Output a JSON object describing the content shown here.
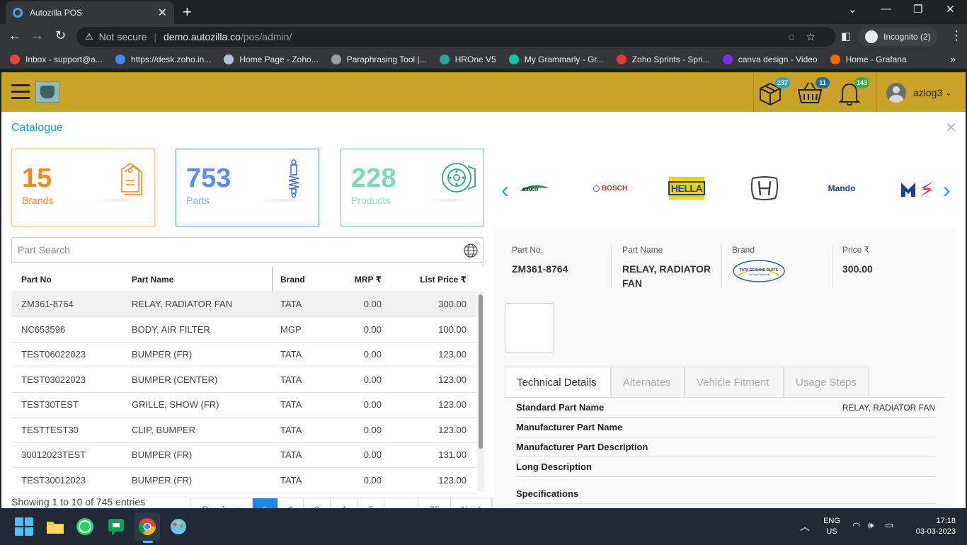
{
  "browser": {
    "tab_title": "Autozilla POS",
    "security_label": "Not secure",
    "url_host": "demo.autozilla.co",
    "url_path": "/pos/admin/",
    "incognito_label": "Incognito (2)"
  },
  "bookmarks": [
    {
      "label": "Inbox - support@a...",
      "color": "#ea4335"
    },
    {
      "label": "https://desk.zoho.in...",
      "color": "#4285f4"
    },
    {
      "label": "Home Page - Zoho...",
      "color": "#b0c4de"
    },
    {
      "label": "Paraphrasing Tool |...",
      "color": "#9aa0a6"
    },
    {
      "label": "HROne V5",
      "color": "#26a69a"
    },
    {
      "label": "My Grammarly - Gr...",
      "color": "#15c39a"
    },
    {
      "label": "Zoho Sprints - Spri...",
      "color": "#e53935"
    },
    {
      "label": "canva design - Video",
      "color": "#7d2ae8"
    },
    {
      "label": "Home - Grafana",
      "color": "#f46800"
    }
  ],
  "header": {
    "badges": {
      "packages": "237",
      "cart": "11",
      "notifications": "143"
    },
    "username": "azlog3"
  },
  "page": {
    "title": "Catalogue",
    "stats": [
      {
        "value": "15",
        "label": "Brands",
        "color": "#f08a24"
      },
      {
        "value": "753",
        "label": "Parts",
        "color": "#5a8ee8"
      },
      {
        "value": "228",
        "label": "Products",
        "color": "#7fd9b8"
      }
    ],
    "brand_logos": [
      "BANCO",
      "BOSCH",
      "HELLA",
      "Honda",
      "Mando",
      "Maruti Suzuki"
    ],
    "search_placeholder": "Part Search",
    "table": {
      "headers": [
        "Part No",
        "Part Name",
        "Brand",
        "MRP ₹",
        "List Price ₹"
      ],
      "rows": [
        [
          "ZM361-8764",
          "RELAY, RADIATOR FAN",
          "TATA",
          "0.00",
          "300.00"
        ],
        [
          "NC653596",
          "BODY, AIR FILTER",
          "MGP",
          "0.00",
          "100.00"
        ],
        [
          "TEST06022023",
          "BUMPER (FR)",
          "TATA",
          "0.00",
          "123.00"
        ],
        [
          "TEST03022023",
          "BUMPER (CENTER)",
          "TATA",
          "0.00",
          "123.00"
        ],
        [
          "TEST30TEST",
          "GRILLE, SHOW (FR)",
          "TATA",
          "0.00",
          "123.00"
        ],
        [
          "TESTTEST30",
          "CLIP, BUMPER",
          "TATA",
          "0.00",
          "123.00"
        ],
        [
          "30012023TEST",
          "BUMPER (FR)",
          "TATA",
          "0.00",
          "131.00"
        ],
        [
          "TEST30012023",
          "BUMPER (FR)",
          "TATA",
          "0.00",
          "123.00"
        ]
      ]
    },
    "showing": "Showing 1 to 10 of 745 entries",
    "pagination": [
      "Previous",
      "1",
      "2",
      "3",
      "4",
      "5",
      "...",
      "75",
      "Next"
    ],
    "detail": {
      "part_no_label": "Part No.",
      "part_no": "ZM361-8764",
      "part_name_label": "Part Name",
      "part_name": "RELAY, RADIATOR FAN",
      "brand_label": "Brand",
      "brand_logo_line1": "TATA GENUINE PARTS",
      "brand_logo_line2": "Let's go beyond",
      "price_label": "Price ₹",
      "price": "300.00",
      "tabs": [
        "Technical Details",
        "Alternates",
        "Vehicle Fitment",
        "Usage Steps"
      ],
      "specs": [
        {
          "key": "Standard Part Name",
          "value": "RELAY, RADIATOR FAN"
        },
        {
          "key": "Manufacturer Part Name",
          "value": ""
        },
        {
          "key": "Manufacturer Part Description",
          "value": ""
        },
        {
          "key": "Long Description",
          "value": ""
        },
        {
          "key": "Specifications",
          "value": ""
        }
      ]
    }
  },
  "taskbar": {
    "lang1": "ENG",
    "lang2": "US",
    "time": "17:18",
    "date": "03-03-2023"
  }
}
